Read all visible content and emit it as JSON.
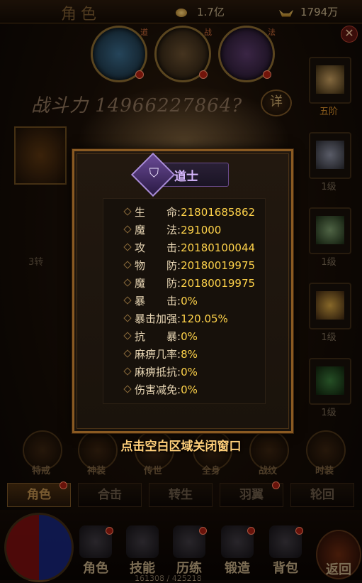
{
  "header": {
    "title": "角色",
    "gold": "1.7亿",
    "ingot": "1794万"
  },
  "heroes": [
    {
      "tag": "道"
    },
    {
      "tag": "战"
    },
    {
      "tag": "法"
    }
  ],
  "power": {
    "label": "战斗力",
    "value": "14966227864?",
    "detail_label": "详"
  },
  "equipment": {
    "left_label": "3转",
    "right_slots": [
      {
        "label": "五阶",
        "highlight": true
      },
      {
        "label": "1级"
      },
      {
        "label": "1级"
      },
      {
        "label": "1级"
      },
      {
        "label": "1级"
      }
    ]
  },
  "modal": {
    "class_glyph": "⛉",
    "class_name": "道士",
    "stats": [
      {
        "key": "生　　命:",
        "value": "21801685862"
      },
      {
        "key": "魔　　法:",
        "value": "291000"
      },
      {
        "key": "攻　　击:",
        "value": "20180100044"
      },
      {
        "key": "物　　防:",
        "value": "20180019975"
      },
      {
        "key": "魔　　防:",
        "value": "20180019975"
      },
      {
        "key": "暴　　击:",
        "value": "0%"
      },
      {
        "key": "暴击加强:",
        "value": "120.05%"
      },
      {
        "key": "抗　　暴:",
        "value": "0%"
      },
      {
        "key": "麻痹几率:",
        "value": "8%"
      },
      {
        "key": "麻痹抵抗:",
        "value": "0%"
      },
      {
        "key": "伤害减免:",
        "value": "0%"
      }
    ]
  },
  "close_hint": "点击空白区域关闭窗口",
  "feature_icons": [
    "特戒",
    "神装",
    "传世",
    "全身",
    "战纹",
    "时装"
  ],
  "tabs": [
    {
      "label": "角色",
      "active": true,
      "dot": true
    },
    {
      "label": "合击"
    },
    {
      "label": "转生"
    },
    {
      "label": "羽翼",
      "dot": true
    },
    {
      "label": "轮回"
    }
  ],
  "nav": [
    {
      "label": "角色",
      "dot": true
    },
    {
      "label": "技能"
    },
    {
      "label": "历练",
      "dot": true
    },
    {
      "label": "锻造",
      "dot": true
    },
    {
      "label": "背包",
      "dot": true
    }
  ],
  "back_label": "返回",
  "exp_text": "161308 / 425218"
}
